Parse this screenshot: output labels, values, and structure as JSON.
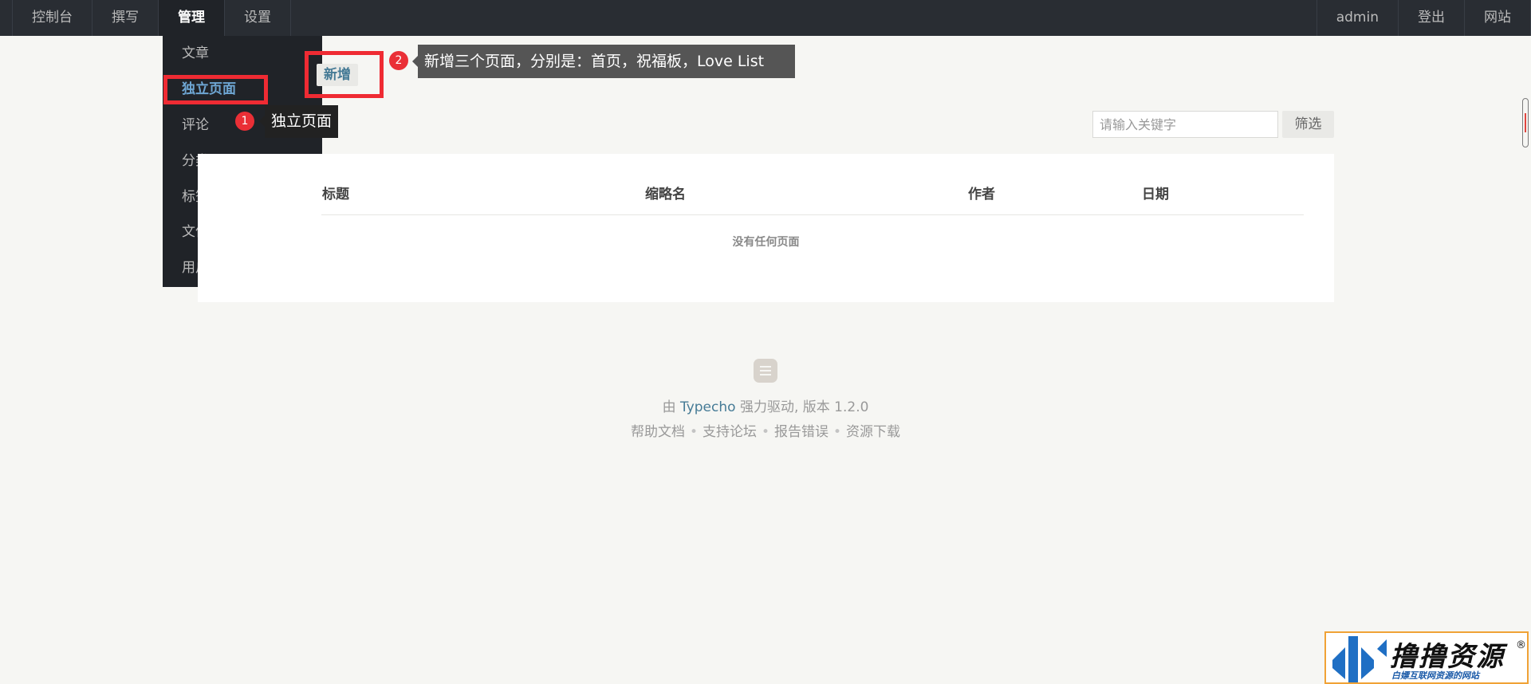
{
  "topnav": {
    "left": [
      {
        "label": "控制台"
      },
      {
        "label": "撰写"
      },
      {
        "label": "管理",
        "active": true
      },
      {
        "label": "设置"
      }
    ],
    "right": [
      {
        "label": "admin"
      },
      {
        "label": "登出"
      },
      {
        "label": "网站"
      }
    ]
  },
  "dropdown": {
    "items": [
      {
        "label": "文章"
      },
      {
        "label": "独立页面",
        "active": true
      },
      {
        "label": "评论"
      },
      {
        "label": "分类"
      },
      {
        "label": "标签"
      },
      {
        "label": "文件"
      },
      {
        "label": "用户"
      }
    ]
  },
  "toolbar": {
    "add_label": "新增",
    "search_placeholder": "请输入关键字",
    "search_value": "",
    "filter_label": "筛选"
  },
  "table": {
    "columns": [
      "标题",
      "缩略名",
      "作者",
      "日期"
    ],
    "empty_message": "没有任何页面"
  },
  "footer": {
    "prefix": "由",
    "brand": "Typecho",
    "suffix": "强力驱动, 版本 1.2.0",
    "links": [
      "帮助文档",
      "支持论坛",
      "报告错误",
      "资源下载"
    ],
    "separator": "•"
  },
  "annotations": [
    {
      "number": "1",
      "text": "独立页面"
    },
    {
      "number": "2",
      "text": "新增三个页面，分别是：首页，祝福板，Love List"
    }
  ],
  "watermark": {
    "title": "撸撸资源",
    "registered": "®",
    "subtitle": "白嫖互联网资源的网站"
  },
  "colors": {
    "nav_bg": "#292d33",
    "dropdown_bg": "#202328",
    "active_link": "#6ea6d3",
    "brand_link": "#467b96",
    "highlight_red": "#ef2b33",
    "page_bg": "#f6f6f3"
  }
}
